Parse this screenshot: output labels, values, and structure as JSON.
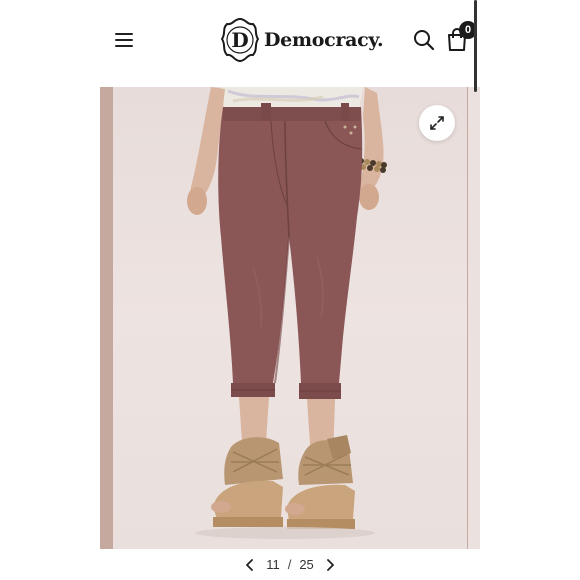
{
  "header": {
    "brand_name": "Democracy.",
    "logo_letter": "D",
    "cart_count": "0"
  },
  "gallery": {
    "current_page": "11",
    "separator": "/",
    "total_pages": "25"
  },
  "product": {
    "color": "#8a5656"
  },
  "icons": {
    "menu": "hamburger-menu-icon",
    "search": "search-icon",
    "cart": "shopping-bag-icon",
    "expand": "expand-arrows-icon",
    "prev": "chevron-left-icon",
    "next": "chevron-right-icon"
  }
}
